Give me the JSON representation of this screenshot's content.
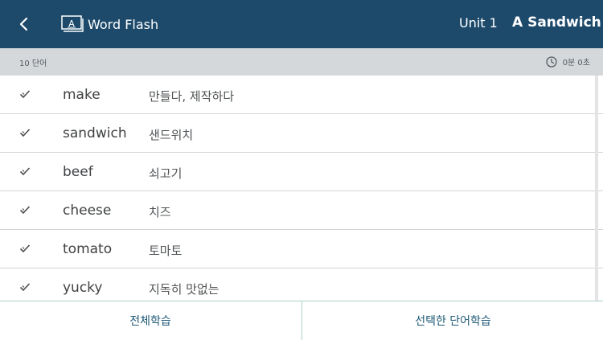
{
  "header": {
    "back_icon": "chevron-left-icon",
    "app_icon": "word-card-icon",
    "app_title": "Word Flash",
    "unit_label": "Unit 1",
    "lesson_title": "A Sandwich",
    "background_color": "#1d4a6b"
  },
  "subbar": {
    "word_count": "10 단어",
    "timer_icon": "clock-icon",
    "timer": "0분 0초"
  },
  "words": [
    {
      "word": "make",
      "meaning": "만들다, 제작하다"
    },
    {
      "word": "sandwich",
      "meaning": "샌드위치"
    },
    {
      "word": "beef",
      "meaning": "쇠고기"
    },
    {
      "word": "cheese",
      "meaning": "치즈"
    },
    {
      "word": "tomato",
      "meaning": "토마토"
    },
    {
      "word": "yucky",
      "meaning": "지독히 맛없는"
    }
  ],
  "footer": {
    "study_all": "전체학습",
    "study_selected": "선택한 단어학습",
    "accent_color": "#1d5876"
  }
}
